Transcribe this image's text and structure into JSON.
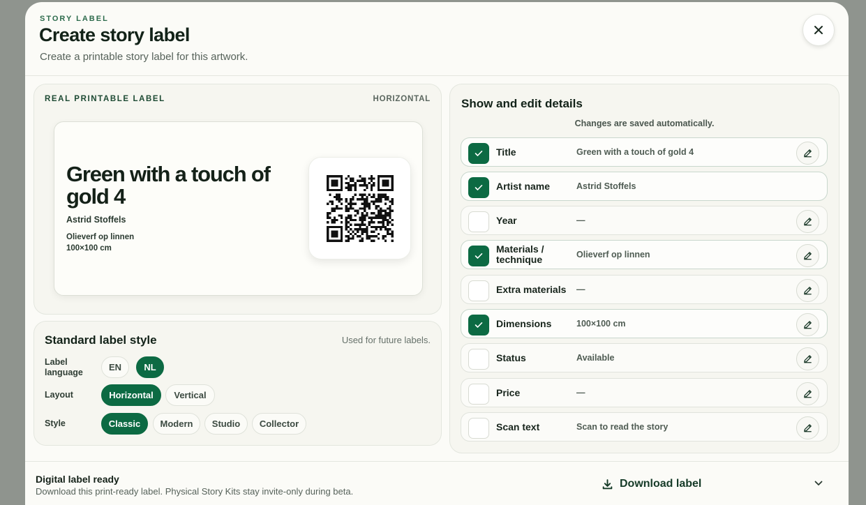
{
  "header": {
    "eyebrow": "STORY LABEL",
    "title": "Create story label",
    "subtitle": "Create a printable story label for this artwork."
  },
  "preview": {
    "eyebrow": "REAL PRINTABLE LABEL",
    "orientation": "HORIZONTAL",
    "artwork": {
      "title": "Green with a touch of gold 4",
      "artist": "Astrid Stoffels",
      "materials": "Olieverf op linnen",
      "dimensions": "100×100 cm"
    }
  },
  "style_settings": {
    "title": "Standard label style",
    "hint": "Used for future labels.",
    "language": {
      "label": "Label language",
      "options": [
        "EN",
        "NL"
      ],
      "selected": "NL"
    },
    "layout": {
      "label": "Layout",
      "options": [
        "Horizontal",
        "Vertical"
      ],
      "selected": "Horizontal"
    },
    "style": {
      "label": "Style",
      "options": [
        "Classic",
        "Modern",
        "Studio",
        "Collector"
      ],
      "selected": "Classic"
    }
  },
  "details": {
    "title": "Show and edit details",
    "note": "Changes are saved automatically.",
    "rows": [
      {
        "label": "Title",
        "value": "Green with a touch of gold 4",
        "checked": true,
        "editable": true
      },
      {
        "label": "Artist name",
        "value": "Astrid Stoffels",
        "checked": true,
        "editable": false
      },
      {
        "label": "Year",
        "value": "—",
        "checked": false,
        "editable": true
      },
      {
        "label": "Materials / technique",
        "value": "Olieverf op linnen",
        "checked": true,
        "editable": true
      },
      {
        "label": "Extra materials",
        "value": "—",
        "checked": false,
        "editable": true
      },
      {
        "label": "Dimensions",
        "value": "100×100 cm",
        "checked": true,
        "editable": true
      },
      {
        "label": "Status",
        "value": "Available",
        "checked": false,
        "editable": true
      },
      {
        "label": "Price",
        "value": "—",
        "checked": false,
        "editable": true
      },
      {
        "label": "Scan text",
        "value": "Scan to read the story",
        "checked": false,
        "editable": true
      }
    ]
  },
  "footer": {
    "title": "Digital label ready",
    "subtitle": "Download this print-ready label. Physical Story Kits stay invite-only during beta.",
    "download_label": "Download label"
  },
  "icons": {
    "close": "close-icon",
    "check": "check-icon",
    "edit": "pencil-icon",
    "download": "download-icon",
    "chevron": "chevron-down-icon",
    "qr": "qr-code-icon"
  },
  "colors": {
    "accent": "#0c6a43",
    "background": "#fbfbf7",
    "overlay": "#8f948e"
  }
}
